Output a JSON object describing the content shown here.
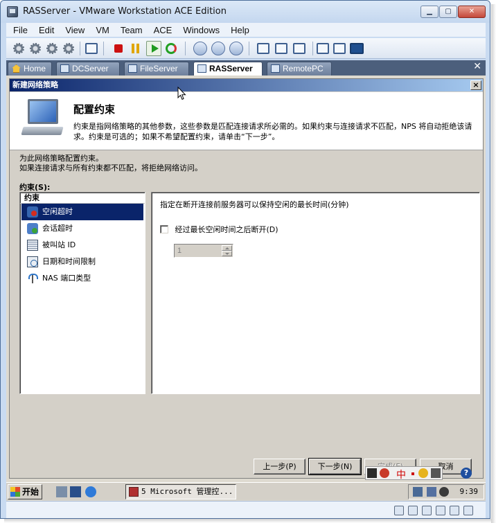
{
  "window": {
    "title": "RASServer - VMware Workstation ACE Edition"
  },
  "menu": [
    "File",
    "Edit",
    "View",
    "VM",
    "Team",
    "ACE",
    "Windows",
    "Help"
  ],
  "tabs": [
    {
      "label": "Home"
    },
    {
      "label": "DCServer"
    },
    {
      "label": "FileServer"
    },
    {
      "label": "RASServer"
    },
    {
      "label": "RemotePC"
    }
  ],
  "dialog": {
    "title": "新建网络策略",
    "header_title": "配置约束",
    "header_desc": "约束是指网络策略的其他参数，这些参数是匹配连接请求所必需的。如果约束与连接请求不匹配，NPS 将自动拒绝该请求。约束是可选的；如果不希望配置约束，请单击“下一步”。",
    "intro_line1": "为此网络策略配置约束。",
    "intro_line2": "如果连接请求与所有约束都不匹配，将拒绝网络访问。",
    "list_label": "约束(S):",
    "list_header": "约束",
    "items": [
      "空闲超时",
      "会话超时",
      "被叫站 ID",
      "日期和时间限制",
      "NAS 端口类型"
    ],
    "panel_desc": "指定在断开连接前服务器可以保持空闲的最长时间(分钟)",
    "checkbox_label": "经过最长空闲时间之后断开(D)",
    "spin_value": "1",
    "buttons": {
      "prev": "上一步(P)",
      "next": "下一步(N)",
      "finish": "完成(F)",
      "cancel": "取消"
    }
  },
  "ime": {
    "lang": "中"
  },
  "help": {
    "label": "?"
  },
  "taskbar": {
    "start": "开始",
    "task": "5 Microsoft 管理控...",
    "clock": "9:39"
  }
}
